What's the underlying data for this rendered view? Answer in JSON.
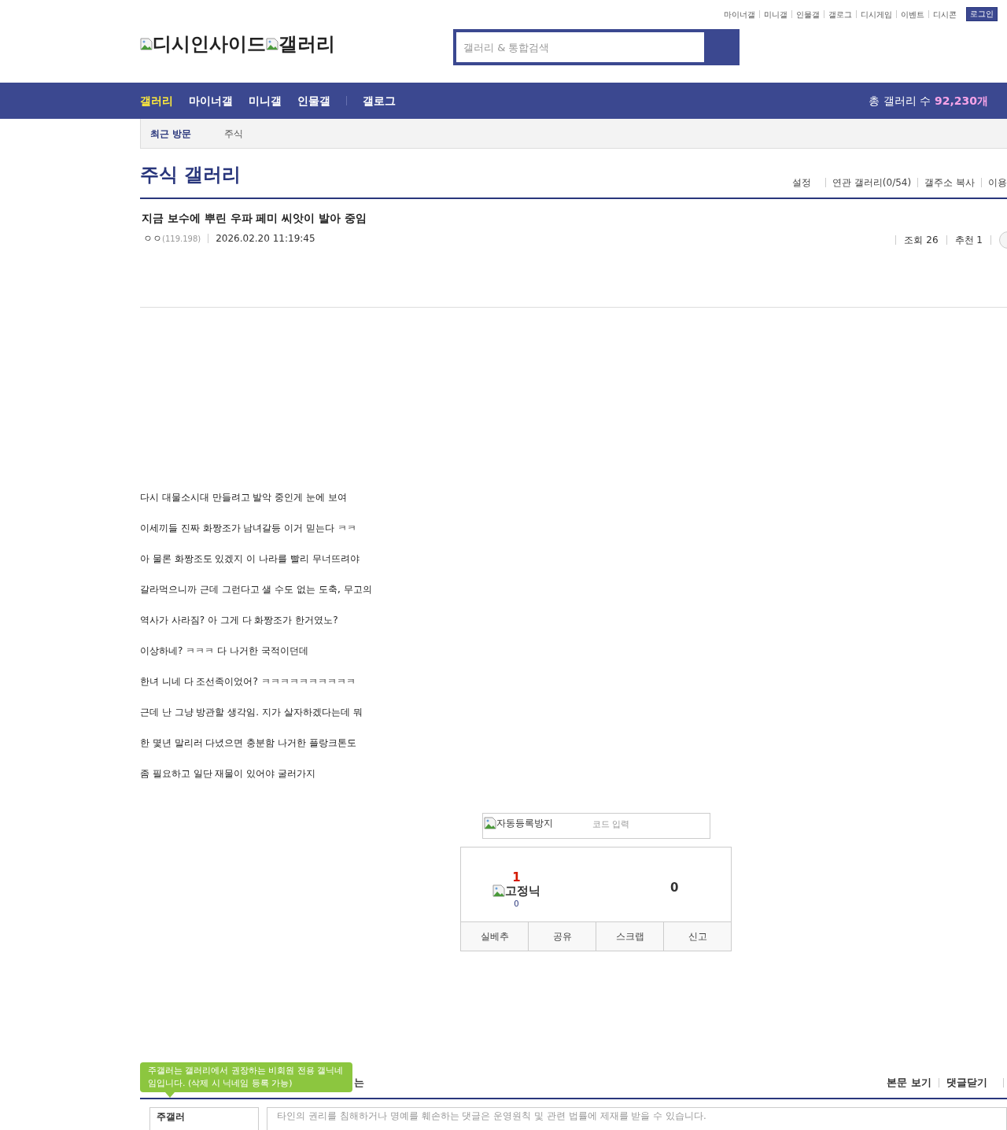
{
  "top_links": [
    "마이너갤",
    "미니갤",
    "인물갤",
    "갤로그",
    "디시게임",
    "이벤트",
    "디시콘"
  ],
  "login_button": "로그인",
  "logo": {
    "site_alt": "디시인사이드",
    "gallery_alt": "갤러리"
  },
  "search": {
    "placeholder": "갤러리 & 통합검색"
  },
  "nav": {
    "items": [
      {
        "label": "갤러리",
        "selected": true
      },
      {
        "label": "마이너갤",
        "selected": false
      },
      {
        "label": "미니갤",
        "selected": false
      },
      {
        "label": "인물갤",
        "selected": false
      },
      {
        "label": "갤로그",
        "selected": false
      }
    ],
    "total_label": "총 갤러리 수",
    "total_count": "92,230개"
  },
  "recent": {
    "label": "최근 방문",
    "items": [
      "주식"
    ]
  },
  "gallery": {
    "title": "주식 갤러리",
    "actions": [
      "설정",
      "연관 갤러리(0/54)",
      "갤주소 복사",
      "이용"
    ]
  },
  "post": {
    "title": "지금 보수에 뿌린 우파 페미 씨앗이 발아 중임",
    "author": "ㅇㅇ",
    "ip": "(119.198)",
    "date": "2026.02.20 11:19:45",
    "views": "조회 26",
    "recommend": "추천 1",
    "body": [
      "다시 대물소시대 만들려고 발악 중인게 눈에 보여",
      "이세끼들 진짜 화짱조가 남녀갈등 이거 믿는다 ㅋㅋ",
      "아 물론 화짱조도 있겠지 이 나라를 빨리 무너뜨려야",
      "갈라먹으니까 근데 그런다고 샐 수도 없는 도축, 무고의",
      "역사가 사라짐? 아 그게 다 화짱조가 한거였노?",
      "이상하네? ㅋㅋㅋ 다 나거한 국적이던데",
      "한녀 니네 다 조선족이었어? ㅋㅋㅋㅋㅋㅋㅋㅋㅋㅋ",
      "근데 난 그냥 방관할 생각임. 지가 살자하겠다는데 뭐",
      "한 몇년 말리러 다녔으면 충분함 나거한 플랑크톤도",
      "좀 필요하고 일단 재물이 있어야 굴러가지"
    ]
  },
  "captcha": {
    "image_alt": "자동등록방지",
    "placeholder": "코드 입력"
  },
  "vote": {
    "up_count": "1",
    "fixed_nick_alt": "고정닉",
    "fixed_nick_count": "0",
    "down_count": "0",
    "buttons": [
      "실베추",
      "공유",
      "스크랩",
      "신고"
    ]
  },
  "comments": {
    "heading_tail": "는",
    "tooltip": "주갤러는 갤러리에서 권장하는 비회원 전용 갤닉네임입니다. (삭제 시 닉네임 등록 가능)",
    "links": [
      "본문 보기",
      "댓글닫기"
    ],
    "nickname": "주갤러",
    "textarea_placeholder": "타인의 권리를 침해하거나 명예를 훼손하는 댓글은 운영원칙 및 관련 법률에 제재를 받을 수 있습니다."
  }
}
